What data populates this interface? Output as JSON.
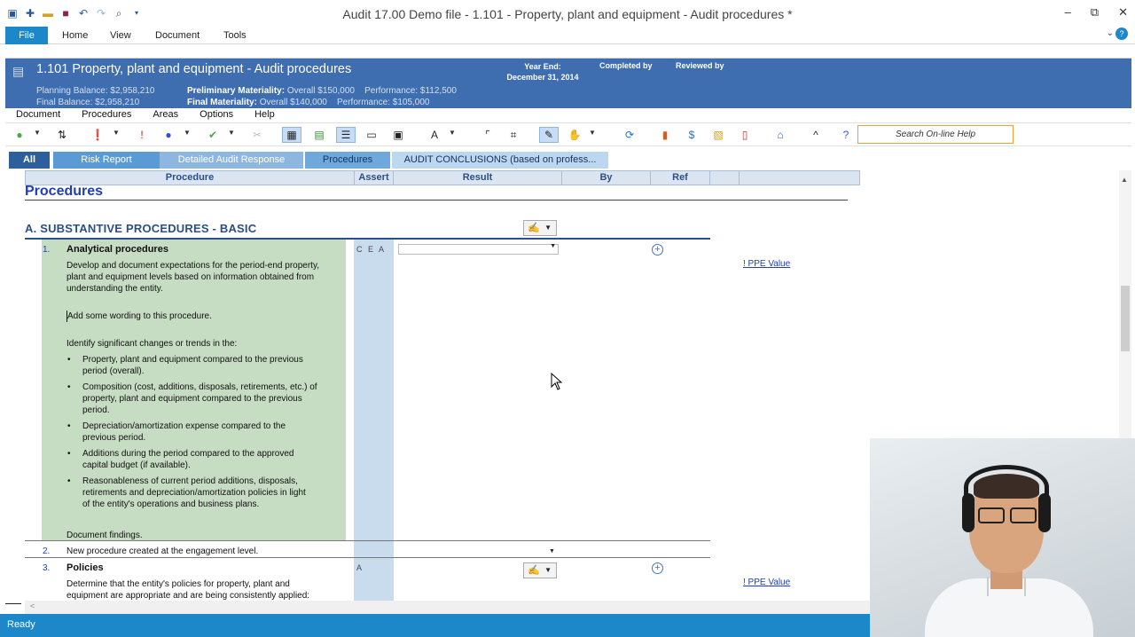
{
  "window": {
    "title": "Audit 17.00 Demo file - 1.101 - Property, plant and equipment - Audit procedures *"
  },
  "ribbon": {
    "tabs": [
      "File",
      "Home",
      "View",
      "Document",
      "Tools"
    ]
  },
  "header": {
    "title": "1.101 Property, plant and equipment - Audit procedures",
    "year_end_label": "Year End:",
    "year_end_value": "December 31, 2014",
    "completed_by": "Completed by",
    "reviewed_by": "Reviewed by",
    "planning_balance_label": "Planning Balance:",
    "planning_balance_value": "$2,958,210",
    "final_balance_label": "Final Balance:",
    "final_balance_value": "$2,958,210",
    "prelim_materiality_label": "Preliminary Materiality:",
    "prelim_overall": "Overall $150,000",
    "prelim_performance": "Performance: $112,500",
    "final_materiality_label": "Final Materiality:",
    "final_overall": "Overall $140,000",
    "final_performance": "Performance: $105,000"
  },
  "menu": [
    "Document",
    "Procedures",
    "Areas",
    "Options",
    "Help"
  ],
  "toolbar": {
    "search_placeholder": "Search On-line Help"
  },
  "filter_tabs": [
    "All",
    "Risk Report",
    "Detailed Audit Response",
    "Procedures",
    "AUDIT CONCLUSIONS (based on profess..."
  ],
  "columns": [
    "Procedure",
    "Assert",
    "Result",
    "By",
    "Ref"
  ],
  "content": {
    "heading": "Procedures",
    "section": "A. SUBSTANTIVE PROCEDURES - BASIC",
    "proc1": {
      "number": "1.",
      "title": "Analytical procedures",
      "assert": "C E A",
      "text1": "Develop and document expectations for the period-end property, plant and equipment levels based on information obtained from understanding the entity.",
      "text2": "Add some wording to this procedure.",
      "text3": "Identify significant changes or trends in the:",
      "bullets": [
        "Property, plant and equipment compared to the previous period (overall).",
        "Composition (cost, additions, disposals, retirements, etc.) of property, plant and equipment compared to the previous period.",
        "Depreciation/amortization expense compared to the previous period.",
        "Additions during the period compared to the approved capital budget (if available).",
        "Reasonableness of current period additions, disposals, retirements and depreciation/amortization policies in light of the entity's operations and business plans."
      ],
      "text4": "Document findings.",
      "link": "! PPE Value"
    },
    "proc2": {
      "number": "2.",
      "title": "New procedure created at the engagement level."
    },
    "proc3": {
      "number": "3.",
      "title": "Policies",
      "assert": "A",
      "text": "Determine that the entity's policies for property, plant and equipment are appropriate and are being consistently applied:",
      "link": "! PPE Value"
    }
  },
  "status": {
    "text": "Ready"
  },
  "colors": {
    "accent": "#1c87c9",
    "header_bg": "#3e6db0",
    "procedure_fill": "#c6dcc3",
    "assert_fill": "#c9dcee"
  }
}
